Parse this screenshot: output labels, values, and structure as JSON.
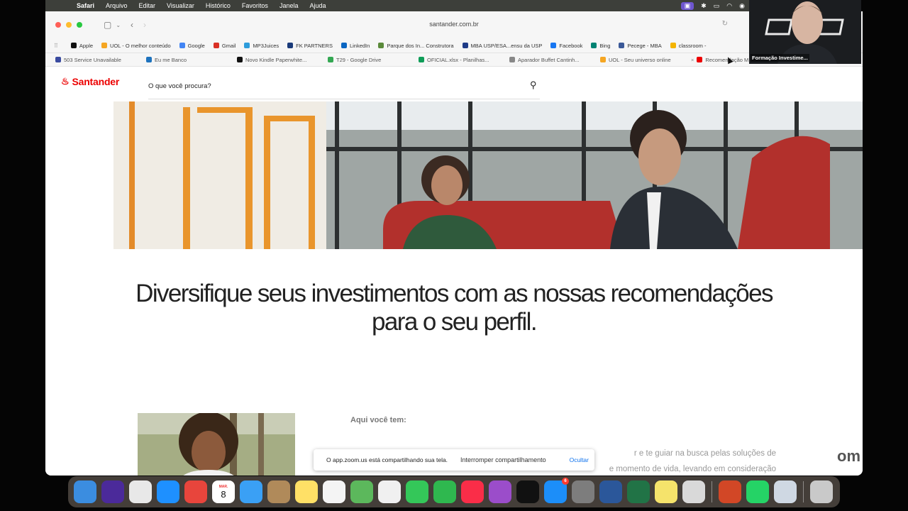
{
  "menubar": {
    "app": "Safari",
    "items": [
      "Arquivo",
      "Editar",
      "Visualizar",
      "Histórico",
      "Favoritos",
      "Janela",
      "Ajuda"
    ]
  },
  "browser": {
    "url": "santander.com.br",
    "favorites": [
      {
        "label": "Apple",
        "color": "#111111"
      },
      {
        "label": "UOL - O melhor conteúdo",
        "color": "#f5a623"
      },
      {
        "label": "Google",
        "color": "#4285f4"
      },
      {
        "label": "Gmail",
        "color": "#d93025"
      },
      {
        "label": "MP3Juices",
        "color": "#2d9cdb"
      },
      {
        "label": "FK PARTNERS",
        "color": "#1a3b7a"
      },
      {
        "label": "LinkedIn",
        "color": "#0a66c2"
      },
      {
        "label": "Parque dos In... Construtora",
        "color": "#5a8a3a"
      },
      {
        "label": "MBA USP/ESA...ensu da USP",
        "color": "#1f3c88"
      },
      {
        "label": "Facebook",
        "color": "#1877f2"
      },
      {
        "label": "Bing",
        "color": "#008373"
      },
      {
        "label": "Pecege - MBA",
        "color": "#3b5998"
      },
      {
        "label": "classroom -",
        "color": "#f4b400"
      }
    ],
    "tabs": [
      {
        "label": "503 Service Unavailable",
        "color": "#3a4ba0"
      },
      {
        "label": "Eu me Banco",
        "color": "#1e73be"
      },
      {
        "label": "Novo Kindle Paperwhite...",
        "color": "#111111"
      },
      {
        "label": "T29 - Google Drive",
        "color": "#34a853"
      },
      {
        "label": "OFICIAL.xlsx - Planilhas...",
        "color": "#0f9d58"
      },
      {
        "label": "Aparador Buffet Cantinh...",
        "color": "#888888"
      },
      {
        "label": "UOL - Seu universo online",
        "color": "#f5a623"
      },
      {
        "label": "Recomendação M",
        "color": "#ec0000"
      }
    ]
  },
  "site": {
    "brand": "Santander",
    "search_placeholder": "O que você procura?",
    "headline_line1": "Diversifique seus investimentos com as nossas recomendações",
    "headline_line2": "para o seu perfil.",
    "section_title": "Aqui você tem:",
    "body_line1": "r e te guiar na busca pelas soluções de",
    "body_line2": "e momento de vida, levando em consideração"
  },
  "share_bar": {
    "message": "O app.zoom.us está compartilhando sua tela.",
    "stop_label": "Interromper compartilhamento",
    "hide_label": "Ocultar"
  },
  "zoom": {
    "participant_name": "Formação Investime...",
    "watermark": "om"
  },
  "dock": {
    "calendar_month": "MAR.",
    "calendar_day": "8",
    "appstore_badge": "6",
    "apps": [
      {
        "name": "finder-icon",
        "color": "#3b8de0"
      },
      {
        "name": "siri-icon",
        "color": "#4b2a9a"
      },
      {
        "name": "launchpad-icon",
        "color": "#e8e8e8"
      },
      {
        "name": "safari-icon",
        "color": "#1e90ff"
      },
      {
        "name": "chrome-icon",
        "color": "#e8453c"
      },
      {
        "name": "calendar-icon",
        "color": "#ffffff"
      },
      {
        "name": "mail-icon",
        "color": "#3aa0f5"
      },
      {
        "name": "contacts-icon",
        "color": "#b08a5a"
      },
      {
        "name": "notes-icon",
        "color": "#ffe066"
      },
      {
        "name": "reminders-icon",
        "color": "#f4f4f4"
      },
      {
        "name": "maps-icon",
        "color": "#5cb85c"
      },
      {
        "name": "photos-icon",
        "color": "#f0f0f0"
      },
      {
        "name": "messages-icon",
        "color": "#34c759"
      },
      {
        "name": "facetime-icon",
        "color": "#2fb84f"
      },
      {
        "name": "music-icon",
        "color": "#fa2d48"
      },
      {
        "name": "podcasts-icon",
        "color": "#9b4dca"
      },
      {
        "name": "tv-icon",
        "color": "#111111"
      },
      {
        "name": "app-store-icon",
        "color": "#1c8ef9"
      },
      {
        "name": "system-settings-icon",
        "color": "#7d7d7d"
      },
      {
        "name": "word-icon",
        "color": "#2b579a"
      },
      {
        "name": "excel-icon",
        "color": "#217346"
      },
      {
        "name": "stickies-icon",
        "color": "#f5e36b"
      },
      {
        "name": "iphone-mirroring-icon",
        "color": "#d9d9d9"
      },
      {
        "name": "powerpoint-icon",
        "color": "#d24726"
      },
      {
        "name": "whatsapp-icon",
        "color": "#25d366"
      },
      {
        "name": "preview-icon",
        "color": "#cfd8e3"
      },
      {
        "name": "trash-icon",
        "color": "#c9c9c9"
      }
    ]
  }
}
